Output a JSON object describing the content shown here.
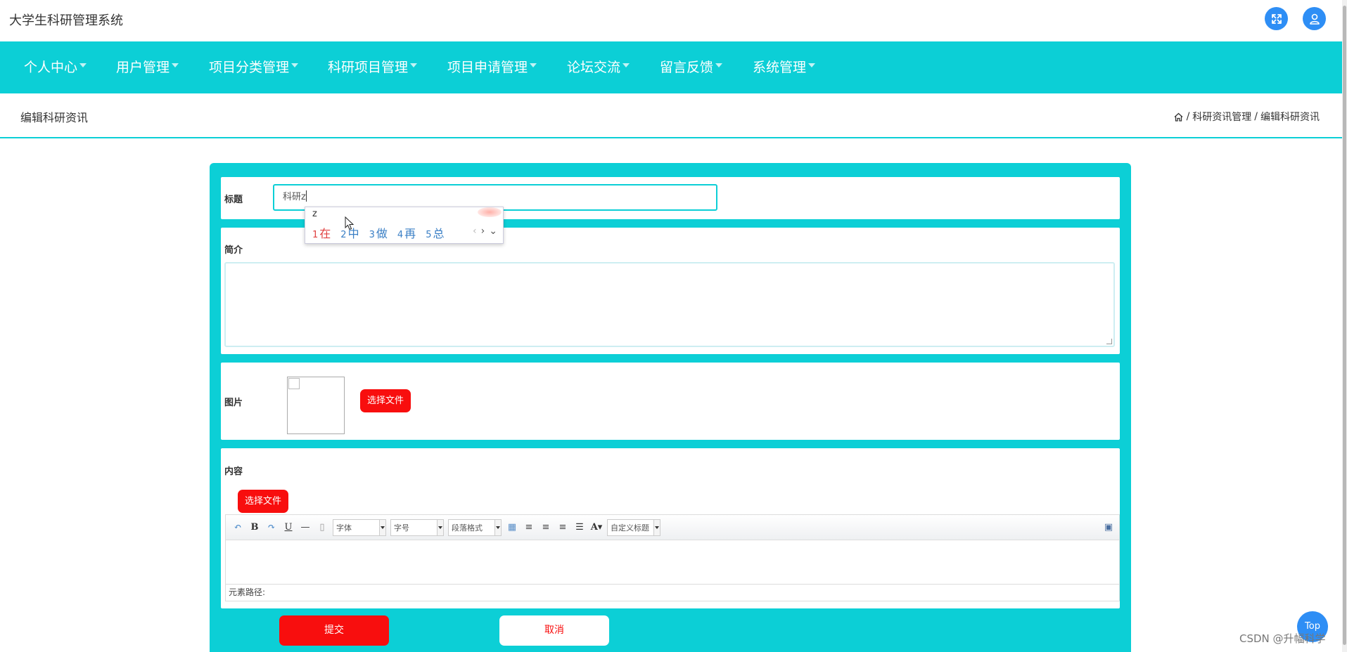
{
  "app": {
    "title": "大学生科研管理系统"
  },
  "header": {
    "fullscreen_icon": "fullscreen-icon",
    "user_icon": "user-icon"
  },
  "nav": {
    "items": [
      {
        "label": "个人中心"
      },
      {
        "label": "用户管理"
      },
      {
        "label": "项目分类管理"
      },
      {
        "label": "科研项目管理"
      },
      {
        "label": "项目申请管理"
      },
      {
        "label": "论坛交流"
      },
      {
        "label": "留言反馈"
      },
      {
        "label": "系统管理"
      }
    ]
  },
  "page": {
    "title": "编辑科研资讯",
    "breadcrumb": {
      "home_icon": "home-icon",
      "separator": "/",
      "level1": "科研资讯管理",
      "level2": "编辑科研资讯"
    }
  },
  "form": {
    "title_label": "标题",
    "title_value": "科研z",
    "intro_label": "简介",
    "intro_value": "",
    "image_label": "图片",
    "image_choose": "选择文件",
    "content_label": "内容",
    "content_choose": "选择文件",
    "submit": "提交",
    "cancel": "取消"
  },
  "editor": {
    "font_select": "字体",
    "size_select": "字号",
    "paragraph_select": "段落格式",
    "custom_title_select": "自定义标题",
    "element_path": "元素路径:"
  },
  "ime": {
    "composition": "z",
    "candidates": [
      {
        "num": "1",
        "text": "在"
      },
      {
        "num": "2",
        "text": "中"
      },
      {
        "num": "3",
        "text": "做"
      },
      {
        "num": "4",
        "text": "再"
      },
      {
        "num": "5",
        "text": "总"
      }
    ],
    "prev": "‹",
    "next": "›",
    "more": "⌄"
  },
  "floating": {
    "top_label": "Top"
  },
  "watermark": "CSDN @升幅科学",
  "colors": {
    "accent": "#0ccfd6",
    "danger": "#f80e0e",
    "blue": "#2e8ef5"
  }
}
